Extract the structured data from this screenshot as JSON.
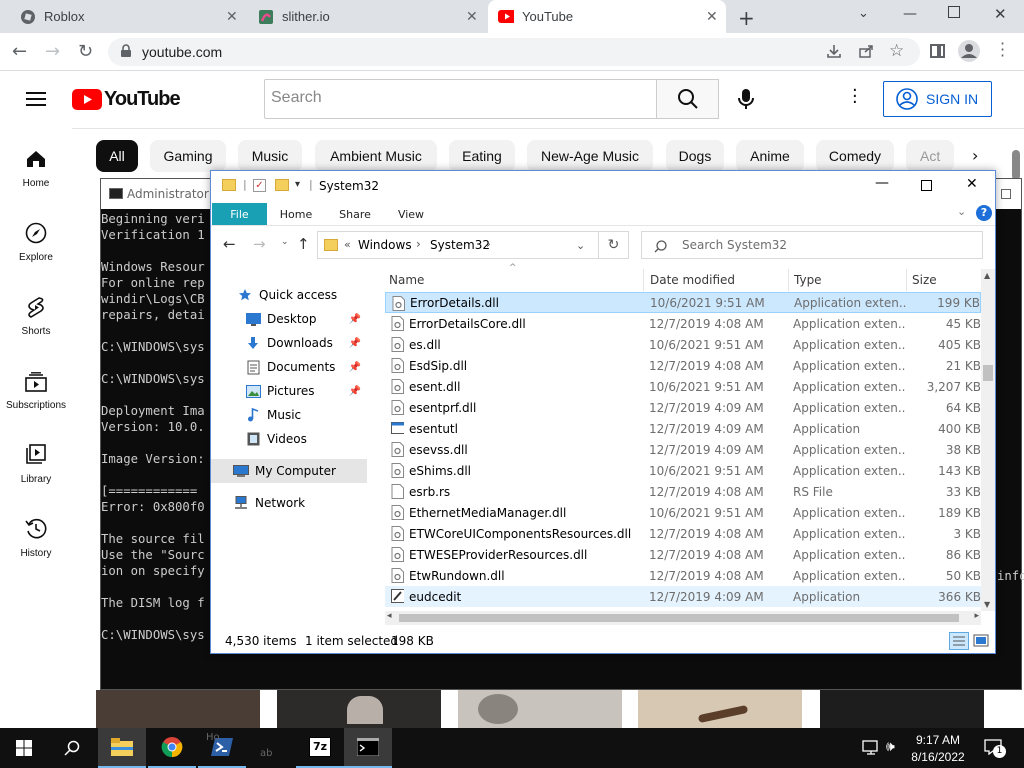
{
  "browser": {
    "tabs": [
      {
        "title": "Roblox"
      },
      {
        "title": "slither.io"
      },
      {
        "title": "YouTube"
      }
    ],
    "url": "youtube.com",
    "colors": {
      "tabbar": "#dee1e6",
      "accent": "#ff0000"
    }
  },
  "youtube": {
    "logo_text": "YouTube",
    "search_placeholder": "Search",
    "sign_in": "SIGN IN",
    "chips": [
      "All",
      "Gaming",
      "Music",
      "Ambient Music",
      "Eating",
      "New-Age Music",
      "Dogs",
      "Anime",
      "Comedy",
      "Act"
    ],
    "guide": [
      "Home",
      "Explore",
      "Shorts",
      "Subscriptions",
      "Library",
      "History"
    ],
    "behind_text": [
      "Ho",
      "ab"
    ]
  },
  "console": {
    "title": "Administrator: C",
    "lines": [
      "Beginning veri",
      "Verification 1",
      "",
      "Windows Resour",
      "For online rep",
      "windir\\Logs\\CB",
      "repairs, detai",
      "",
      "C:\\WINDOWS\\sys",
      "",
      "C:\\WINDOWS\\sys",
      "",
      "Deployment Ima",
      "Version: 10.0.",
      "",
      "Image Version:",
      "",
      "[============",
      "Error: 0x800f0",
      "",
      "The source fil",
      "Use the \"Sourc",
      "ion on specify",
      "",
      "The DISM log f",
      "",
      "C:\\WINDOWS\\sys"
    ],
    "right_fragment": "info"
  },
  "explorer": {
    "title": "System32",
    "ribbon_tabs": [
      "File",
      "Home",
      "Share",
      "View"
    ],
    "breadcrumb": [
      "Windows",
      "System32"
    ],
    "search_placeholder": "Search System32",
    "nav": {
      "quick_access": "Quick access",
      "items": [
        "Desktop",
        "Downloads",
        "Documents",
        "Pictures",
        "Music",
        "Videos"
      ],
      "my_computer": "My Computer",
      "network": "Network"
    },
    "columns": [
      "Name",
      "Date modified",
      "Type",
      "Size"
    ],
    "files": [
      {
        "name": "ErrorDetails.dll",
        "date": "10/6/2021 9:51 AM",
        "type": "Application exten...",
        "size": "199 KB",
        "icon": "dll"
      },
      {
        "name": "ErrorDetailsCore.dll",
        "date": "12/7/2019 4:08 AM",
        "type": "Application exten...",
        "size": "45 KB",
        "icon": "dll"
      },
      {
        "name": "es.dll",
        "date": "10/6/2021 9:51 AM",
        "type": "Application exten...",
        "size": "405 KB",
        "icon": "dll"
      },
      {
        "name": "EsdSip.dll",
        "date": "12/7/2019 4:08 AM",
        "type": "Application exten...",
        "size": "21 KB",
        "icon": "dll"
      },
      {
        "name": "esent.dll",
        "date": "10/6/2021 9:51 AM",
        "type": "Application exten...",
        "size": "3,207 KB",
        "icon": "dll"
      },
      {
        "name": "esentprf.dll",
        "date": "12/7/2019 4:09 AM",
        "type": "Application exten...",
        "size": "64 KB",
        "icon": "dll"
      },
      {
        "name": "esentutl",
        "date": "12/7/2019 4:09 AM",
        "type": "Application",
        "size": "400 KB",
        "icon": "exe"
      },
      {
        "name": "esevss.dll",
        "date": "12/7/2019 4:09 AM",
        "type": "Application exten...",
        "size": "38 KB",
        "icon": "dll"
      },
      {
        "name": "eShims.dll",
        "date": "10/6/2021 9:51 AM",
        "type": "Application exten...",
        "size": "143 KB",
        "icon": "dll"
      },
      {
        "name": "esrb.rs",
        "date": "12/7/2019 4:08 AM",
        "type": "RS File",
        "size": "33 KB",
        "icon": "file"
      },
      {
        "name": "EthernetMediaManager.dll",
        "date": "10/6/2021 9:51 AM",
        "type": "Application exten...",
        "size": "189 KB",
        "icon": "dll"
      },
      {
        "name": "ETWCoreUIComponentsResources.dll",
        "date": "12/7/2019 4:08 AM",
        "type": "Application exten...",
        "size": "3 KB",
        "icon": "dll"
      },
      {
        "name": "ETWESEProviderResources.dll",
        "date": "12/7/2019 4:08 AM",
        "type": "Application exten...",
        "size": "86 KB",
        "icon": "dll"
      },
      {
        "name": "EtwRundown.dll",
        "date": "12/7/2019 4:08 AM",
        "type": "Application exten...",
        "size": "50 KB",
        "icon": "dll"
      },
      {
        "name": "eudcedit",
        "date": "12/7/2019 4:09 AM",
        "type": "Application",
        "size": "366 KB",
        "icon": "edit"
      }
    ],
    "status": {
      "count": "4,530 items",
      "selected": "1 item selected",
      "size": "198 KB"
    }
  },
  "taskbar": {
    "time": "9:17 AM",
    "date": "8/16/2022",
    "notifications": "1"
  }
}
